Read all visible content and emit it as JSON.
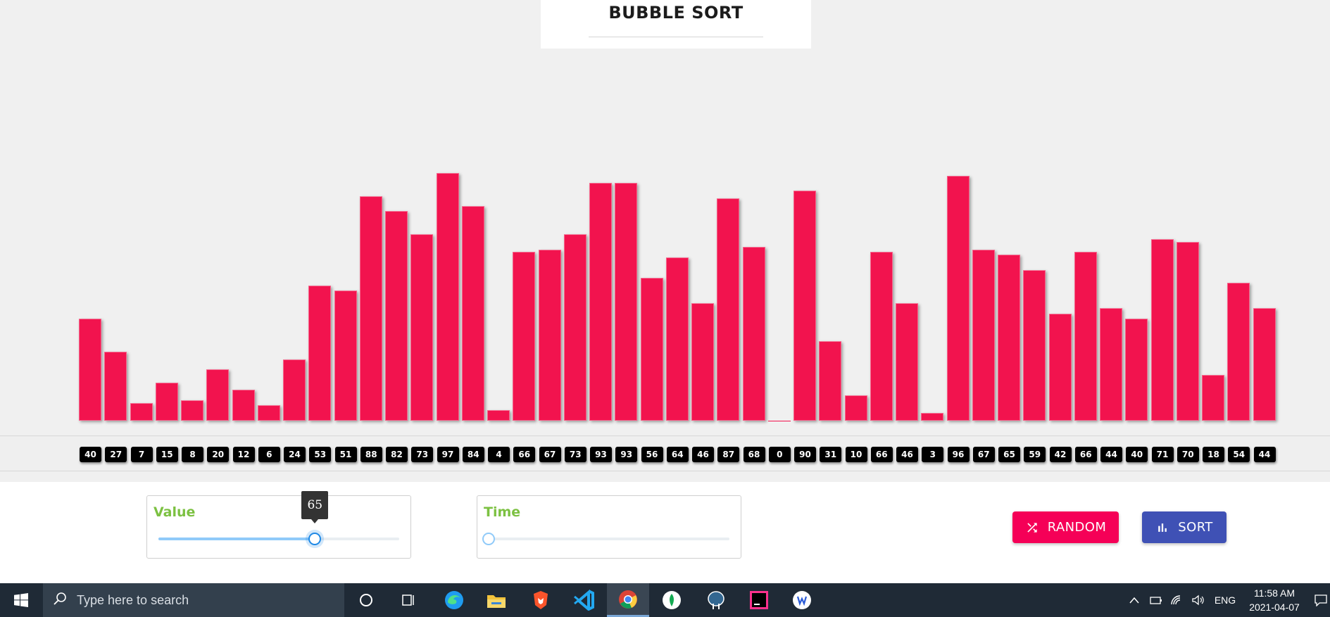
{
  "app": {
    "title": "BUBBLE SORT"
  },
  "chart_data": {
    "type": "bar",
    "values": [
      40,
      27,
      7,
      15,
      8,
      20,
      12,
      6,
      24,
      53,
      51,
      88,
      82,
      73,
      97,
      84,
      4,
      66,
      67,
      73,
      93,
      93,
      56,
      64,
      46,
      87,
      68,
      0,
      90,
      31,
      10,
      66,
      46,
      3,
      96,
      67,
      65,
      59,
      42,
      66,
      44,
      40,
      71,
      70,
      18,
      54,
      44
    ],
    "ylim": [
      0,
      100
    ],
    "bar_color": "#f2134e"
  },
  "controls": {
    "value_slider": {
      "label": "Value",
      "value": 65,
      "min": 0,
      "max": 100,
      "level": 0.65
    },
    "time_slider": {
      "label": "Time",
      "level": 0
    },
    "random_button": {
      "label": "RANDOM",
      "icon": "shuffle-icon"
    },
    "sort_button": {
      "label": "SORT",
      "icon": "bar-chart-icon"
    }
  },
  "taskbar": {
    "search_placeholder": "Type here to search",
    "language": "ENG",
    "time": "11:58 AM",
    "date": "2021-04-07",
    "apps": [
      "cortana-icon",
      "task-view-icon",
      "edge-icon",
      "file-explorer-icon",
      "brave-icon",
      "vscode-icon",
      "chrome-icon",
      "mongodb-compass-icon",
      "pgadmin-icon",
      "intellij-icon",
      "app-icon"
    ]
  },
  "colors": {
    "accent_pink": "#f50057",
    "accent_indigo": "#3f51b5",
    "label_green": "#7cc142",
    "slider_blue": "#1e88e5"
  }
}
